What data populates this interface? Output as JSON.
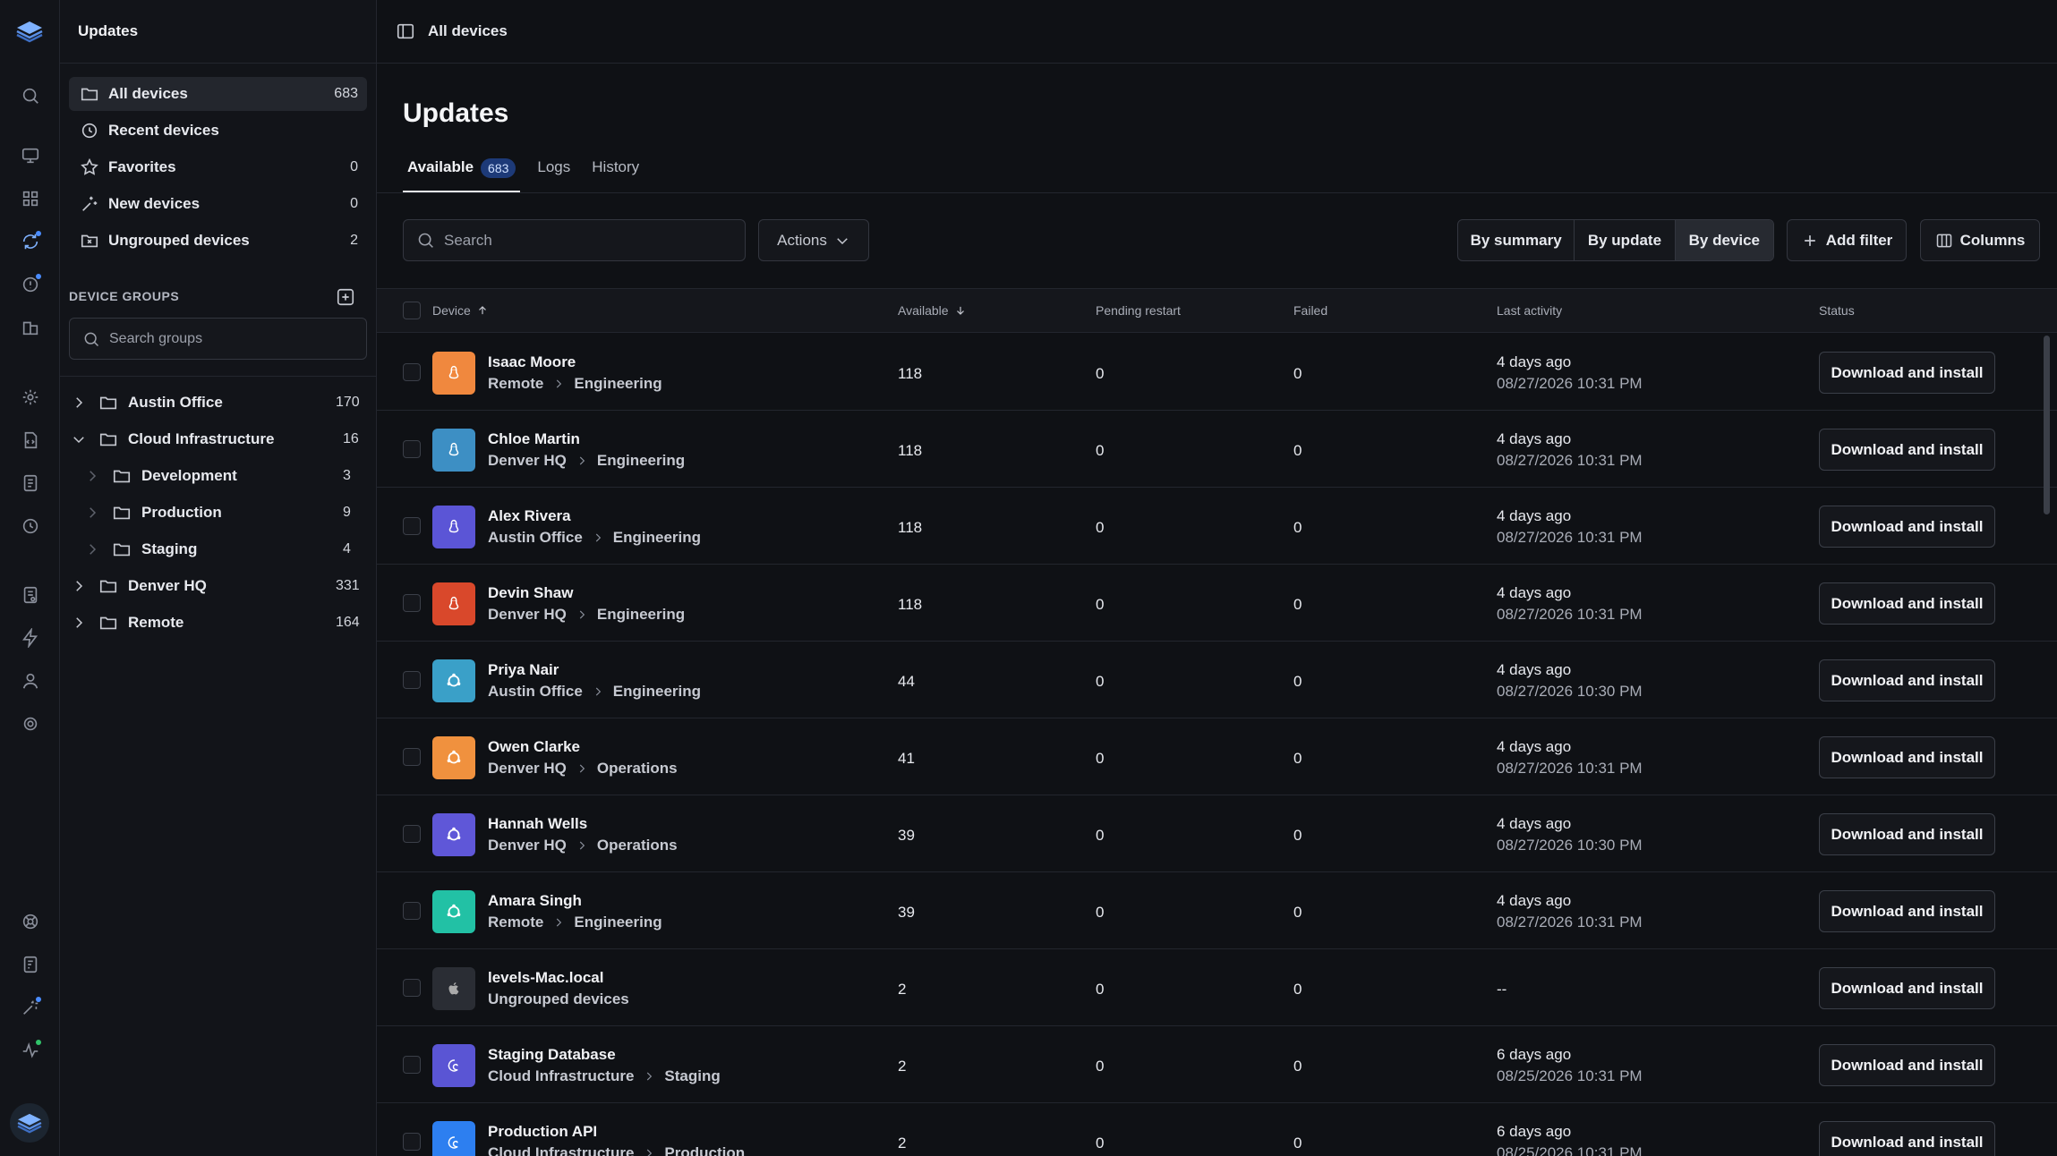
{
  "sidebar": {
    "title": "Updates",
    "nav": [
      {
        "label": "All devices",
        "count": "683",
        "icon": "folder-icon"
      },
      {
        "label": "Recent devices",
        "count": "",
        "icon": "clock-icon"
      },
      {
        "label": "Favorites",
        "count": "0",
        "icon": "star-icon"
      },
      {
        "label": "New devices",
        "count": "0",
        "icon": "sparkle-icon"
      },
      {
        "label": "Ungrouped devices",
        "count": "2",
        "icon": "folder-x-icon"
      }
    ],
    "groups_label": "DEVICE GROUPS",
    "groups_search_placeholder": "Search groups",
    "groups": [
      {
        "label": "Austin Office",
        "count": "170"
      },
      {
        "label": "Cloud Infrastructure",
        "count": "16"
      },
      {
        "label": "Development",
        "count": "3"
      },
      {
        "label": "Production",
        "count": "9"
      },
      {
        "label": "Staging",
        "count": "4"
      },
      {
        "label": "Denver HQ",
        "count": "331"
      },
      {
        "label": "Remote",
        "count": "164"
      }
    ]
  },
  "topbar": {
    "title": "All devices"
  },
  "main": {
    "title": "Updates",
    "tabs": [
      {
        "label": "Available",
        "badge": "683"
      },
      {
        "label": "Logs"
      },
      {
        "label": "History"
      }
    ],
    "search_placeholder": "Search",
    "actions_label": "Actions",
    "views": [
      "By summary",
      "By update",
      "By device"
    ],
    "add_filter_label": "Add filter",
    "columns_label": "Columns"
  },
  "table": {
    "headers": {
      "device": "Device",
      "available": "Available",
      "pending": "Pending restart",
      "failed": "Failed",
      "activity": "Last activity",
      "status": "Status"
    },
    "rows": [
      {
        "name": "Isaac Moore",
        "path": [
          "Remote",
          "Engineering"
        ],
        "available": "118",
        "pending": "0",
        "failed": "0",
        "activity": "4 days ago",
        "date": "08/27/2026 10:31 PM",
        "status": "Download and install",
        "color": "#f0883e",
        "os": "linux"
      },
      {
        "name": "Chloe Martin",
        "path": [
          "Denver HQ",
          "Engineering"
        ],
        "available": "118",
        "pending": "0",
        "failed": "0",
        "activity": "4 days ago",
        "date": "08/27/2026 10:31 PM",
        "status": "Download and install",
        "color": "#3d8fc4",
        "os": "linux"
      },
      {
        "name": "Alex Rivera",
        "path": [
          "Austin Office",
          "Engineering"
        ],
        "available": "118",
        "pending": "0",
        "failed": "0",
        "activity": "4 days ago",
        "date": "08/27/2026 10:31 PM",
        "status": "Download and install",
        "color": "#5b55d6",
        "os": "linux"
      },
      {
        "name": "Devin Shaw",
        "path": [
          "Denver HQ",
          "Engineering"
        ],
        "available": "118",
        "pending": "0",
        "failed": "0",
        "activity": "4 days ago",
        "date": "08/27/2026 10:31 PM",
        "status": "Download and install",
        "color": "#d9482b",
        "os": "linux"
      },
      {
        "name": "Priya Nair",
        "path": [
          "Austin Office",
          "Engineering"
        ],
        "available": "44",
        "pending": "0",
        "failed": "0",
        "activity": "4 days ago",
        "date": "08/27/2026 10:30 PM",
        "status": "Download and install",
        "color": "#3aa0c8",
        "os": "ubuntu"
      },
      {
        "name": "Owen Clarke",
        "path": [
          "Denver HQ",
          "Operations"
        ],
        "available": "41",
        "pending": "0",
        "failed": "0",
        "activity": "4 days ago",
        "date": "08/27/2026 10:31 PM",
        "status": "Download and install",
        "color": "#f0913e",
        "os": "ubuntu"
      },
      {
        "name": "Hannah Wells",
        "path": [
          "Denver HQ",
          "Operations"
        ],
        "available": "39",
        "pending": "0",
        "failed": "0",
        "activity": "4 days ago",
        "date": "08/27/2026 10:30 PM",
        "status": "Download and install",
        "color": "#5f57d8",
        "os": "ubuntu"
      },
      {
        "name": "Amara Singh",
        "path": [
          "Remote",
          "Engineering"
        ],
        "available": "39",
        "pending": "0",
        "failed": "0",
        "activity": "4 days ago",
        "date": "08/27/2026 10:31 PM",
        "status": "Download and install",
        "color": "#22c1a5",
        "os": "ubuntu"
      },
      {
        "name": "levels-Mac.local",
        "path": [
          "Ungrouped devices"
        ],
        "available": "2",
        "pending": "0",
        "failed": "0",
        "activity": "--",
        "date": "",
        "status": "Download and install",
        "color": "#2a2d34",
        "os": "apple"
      },
      {
        "name": "Staging Database",
        "path": [
          "Cloud Infrastructure",
          "Staging"
        ],
        "available": "2",
        "pending": "0",
        "failed": "0",
        "activity": "6 days ago",
        "date": "08/25/2026 10:31 PM",
        "status": "Download and install",
        "color": "#5a55d4",
        "os": "debian"
      },
      {
        "name": "Production API",
        "path": [
          "Cloud Infrastructure",
          "Production"
        ],
        "available": "2",
        "pending": "0",
        "failed": "0",
        "activity": "6 days ago",
        "date": "08/25/2026 10:31 PM",
        "status": "Download and install",
        "color": "#2d7ff0",
        "os": "debian"
      }
    ]
  }
}
